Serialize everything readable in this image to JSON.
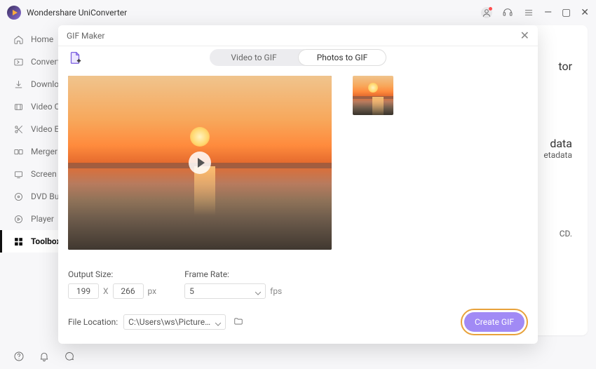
{
  "app": {
    "title": "Wondershare UniConverter"
  },
  "window": {
    "minimize": "—",
    "maximize": "▢",
    "close": "✕"
  },
  "sidebar": {
    "items": [
      {
        "label": "Home"
      },
      {
        "label": "Converter"
      },
      {
        "label": "Downloader"
      },
      {
        "label": "Video Compressor"
      },
      {
        "label": "Video Editor"
      },
      {
        "label": "Merger"
      },
      {
        "label": "Screen Recorder"
      },
      {
        "label": "DVD Burner"
      },
      {
        "label": "Player"
      },
      {
        "label": "Toolbox"
      }
    ]
  },
  "bg": {
    "t1": "tor",
    "t2": "data",
    "t3": "etadata",
    "t4": "CD."
  },
  "modal": {
    "title": "GIF Maker",
    "tabs": {
      "video": "Video to GIF",
      "photos": "Photos to GIF",
      "active": "photos"
    },
    "output_size_label": "Output Size:",
    "output_width": "199",
    "output_height": "266",
    "size_sep": "X",
    "px": "px",
    "frame_rate_label": "Frame Rate:",
    "frame_rate_value": "5",
    "fps": "fps",
    "file_location_label": "File Location:",
    "file_location_value": "C:\\Users\\ws\\Pictures\\Wonders",
    "create": "Create GIF"
  }
}
